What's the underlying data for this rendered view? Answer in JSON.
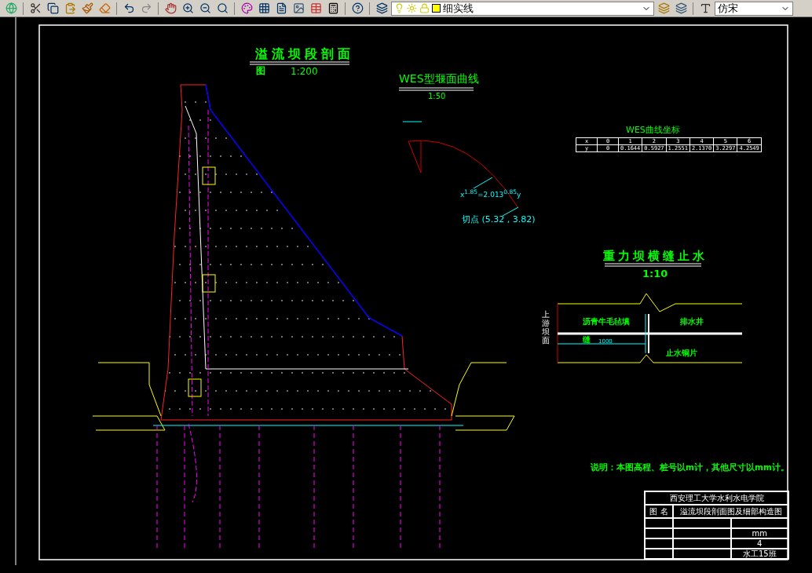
{
  "toolbar": {
    "layer_dropdown": {
      "value": "细实线"
    },
    "font_dropdown": {
      "value": "仿宋"
    }
  },
  "section": {
    "title": "溢流坝段剖面",
    "title_tail": "图",
    "scale": "1:200"
  },
  "wes": {
    "title": "WES型堰面曲线",
    "scale": "1:50",
    "formula": "x$^{1.85}$=2.013$^{0.85}$y",
    "tangent_point": "切点 (5.32 , 3.82)"
  },
  "wes_table": {
    "title": "WES曲线坐标",
    "rows": [
      {
        "cells": [
          "x",
          "0",
          "1",
          "2",
          "3",
          "4",
          "5",
          "6"
        ]
      },
      {
        "cells": [
          "y",
          "0",
          "0.1644",
          "0.5927",
          "1.2551",
          "2.1370",
          "3.2297",
          "4.2549"
        ]
      }
    ]
  },
  "joint": {
    "title": "重力坝横缝止水",
    "scale": "1:10",
    "side_label": "上游坝面",
    "filler_label": "沥青牛毛毡填",
    "filler_label_tail": "缝",
    "drain_label": "排水井",
    "waterstop_label": "止水铜片",
    "dimension": "1000"
  },
  "note": "说明：本图高程、桩号以m计，其他尺寸以mm计。",
  "title_block": {
    "school": "西安理工大学水利水电学院",
    "name_label": "图 名",
    "name": "溢流坝段剖面图及细部构造图",
    "unit": "mm",
    "sheet": "4",
    "class": "水工15班"
  }
}
